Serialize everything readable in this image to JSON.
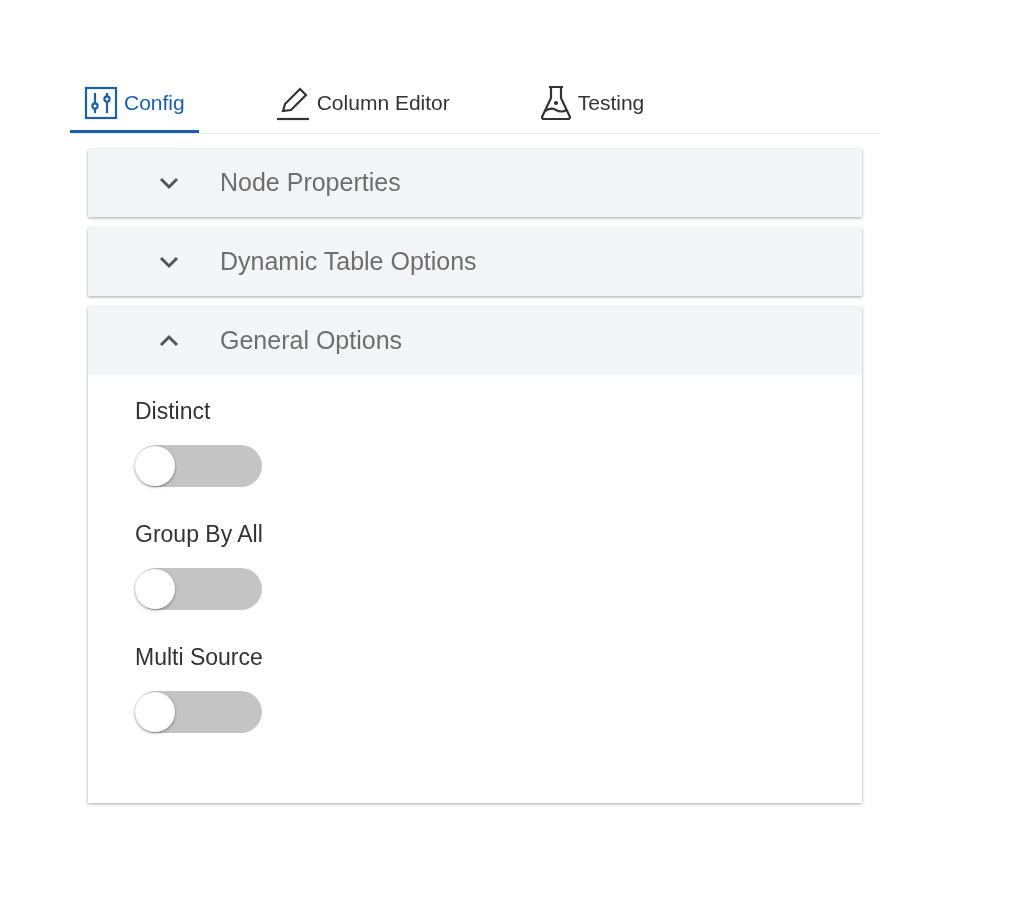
{
  "tabs": [
    {
      "label": "Config",
      "selected": true
    },
    {
      "label": "Column Editor",
      "selected": false
    },
    {
      "label": "Testing",
      "selected": false
    }
  ],
  "panels": [
    {
      "title": "Node Properties",
      "expanded": false
    },
    {
      "title": "Dynamic Table Options",
      "expanded": false
    },
    {
      "title": "General Options",
      "expanded": true,
      "options": [
        {
          "label": "Distinct",
          "on": false
        },
        {
          "label": "Group By All",
          "on": false
        },
        {
          "label": "Multi Source",
          "on": false
        }
      ]
    }
  ]
}
